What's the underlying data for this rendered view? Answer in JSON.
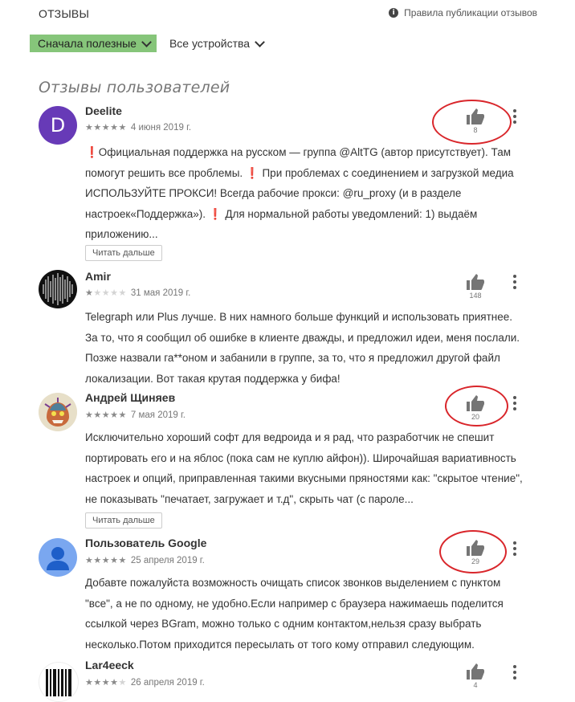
{
  "header": {
    "title": "ОТЗЫВЫ",
    "policy_link": "Правила публикации отзывов",
    "policy_icon": "info-icon"
  },
  "filters": {
    "sort": "Сначала полезные",
    "devices": "Все устройства"
  },
  "section_title": "Отзывы пользователей",
  "colors": {
    "filter_active": "#86c57a",
    "annotation_circle": "#d9262b",
    "avatar_deelite": "#673ab7",
    "avatar_google": "#7aa7f0"
  },
  "reviews": [
    {
      "author": "Deelite",
      "avatar": "D",
      "rating": 5,
      "date": "4 июня 2019 г.",
      "text": "❗Официальная поддержка на русском — группа @AltTG (автор присутствует). Там помогут решить все проблемы. ❗ При проблемах с соединением и загрузкой медиа ИСПОЛЬЗУЙТЕ ПРОКСИ! Всегда рабочие прокси: @ru_proxy (и в разделе настроек«Поддержка»). ❗ Для нормальной работы уведомлений: 1) выдаём приложению...",
      "read_more": "Читать дальше",
      "likes": "8",
      "circled": true
    },
    {
      "author": "Amir",
      "avatar": "sound-wave-avatar",
      "rating": 1,
      "date": "31 мая 2019 г.",
      "text": "Telegraph или Plus лучше. В них намного больше функций и использовать приятнее. За то, что я сообщил об ошибке в клиенте дважды, и предложил идеи, меня послали. Позже назвали га**оном и забанили в группе, за то, что я предложил другой файл локализации. Вот такая крутая поддержка у бифа!",
      "likes": "148",
      "circled": false
    },
    {
      "author": "Андрей Щиняев",
      "avatar": "illustration-avatar",
      "rating": 5,
      "date": "7 мая 2019 г.",
      "text": "Исключительно хороший софт для ведроида и я рад, что разработчик не спешит портировать его и на яблос (пока сам не куплю айфон)). Широчайшая вариативность настроек и опций, приправленная такими вкусными пряностями как: \"скрытое чтение\", не показывать \"печатает, загружает и т.д\", скрыть чат (с пароле...",
      "read_more": "Читать дальше",
      "likes": "20",
      "circled": true
    },
    {
      "author": "Пользователь Google",
      "avatar": "person-icon",
      "rating": 5,
      "date": "25 апреля 2019 г.",
      "text": "Добавте пожалуйста возможность очищать список звонков выделением с пунктом \"все\", а не по одному, не удобно.Если например с браузера нажимаешь поделится ссылкой через BGram, можно только с одним контактом,нельзя сразу выбрать несколько.Потом приходится пересылать от того кому отправил следующим.",
      "likes": "29",
      "circled": true
    },
    {
      "author": "Lar4eeck",
      "avatar": "barcode-avatar",
      "rating": 4,
      "date": "26 апреля 2019 г.",
      "likes": "4",
      "circled": false
    }
  ]
}
